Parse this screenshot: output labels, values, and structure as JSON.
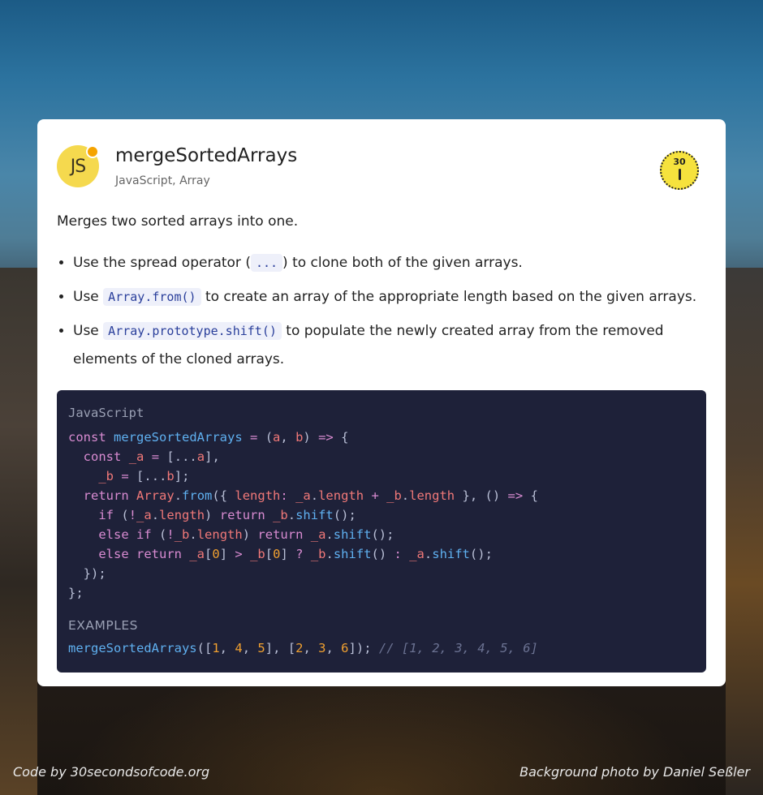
{
  "card": {
    "logo_text": "JS",
    "title": "mergeSortedArrays",
    "tags": "JavaScript, Array",
    "badge_number": "30",
    "description": "Merges two sorted arrays into one.",
    "bullets": [
      {
        "before": "Use the spread operator (",
        "code": "...",
        "after": ") to clone both of the given arrays."
      },
      {
        "before": "Use ",
        "code": "Array.from()",
        "after": " to create an array of the appropriate length based on the given arrays."
      },
      {
        "before": "Use ",
        "code": "Array.prototype.shift()",
        "after": " to populate the newly created array from the removed elements of the cloned arrays."
      }
    ]
  },
  "code": {
    "language": "JavaScript",
    "lines": [
      "const mergeSortedArrays = (a, b) => {",
      "  const _a = [...a],",
      "    _b = [...b];",
      "  return Array.from({ length: _a.length + _b.length }, () => {",
      "    if (!_a.length) return _b.shift();",
      "    else if (!_b.length) return _a.shift();",
      "    else return _a[0] > _b[0] ? _b.shift() : _a.shift();",
      "  });",
      "};"
    ],
    "examples_label": "EXAMPLES",
    "example_call": "mergeSortedArrays([1, 4, 5], [2, 3, 6]);",
    "example_comment": "// [1, 2, 3, 4, 5, 6]"
  },
  "footer": {
    "left": "Code by 30secondsofcode.org",
    "right": "Background photo by Daniel Seßler"
  },
  "colors": {
    "card_bg": "#ffffff",
    "code_bg": "#1e2139",
    "logo_bg": "#f5d94e",
    "logo_dot": "#f5a300",
    "inline_code": "#2a3f9b",
    "keyword": "#d88bd1",
    "function": "#5fb0f0",
    "variable": "#f07878",
    "number": "#f0a030",
    "comment": "#6b7292"
  },
  "icons": {
    "logo": "js-logo-icon",
    "badge": "30-seconds-timer-icon"
  }
}
